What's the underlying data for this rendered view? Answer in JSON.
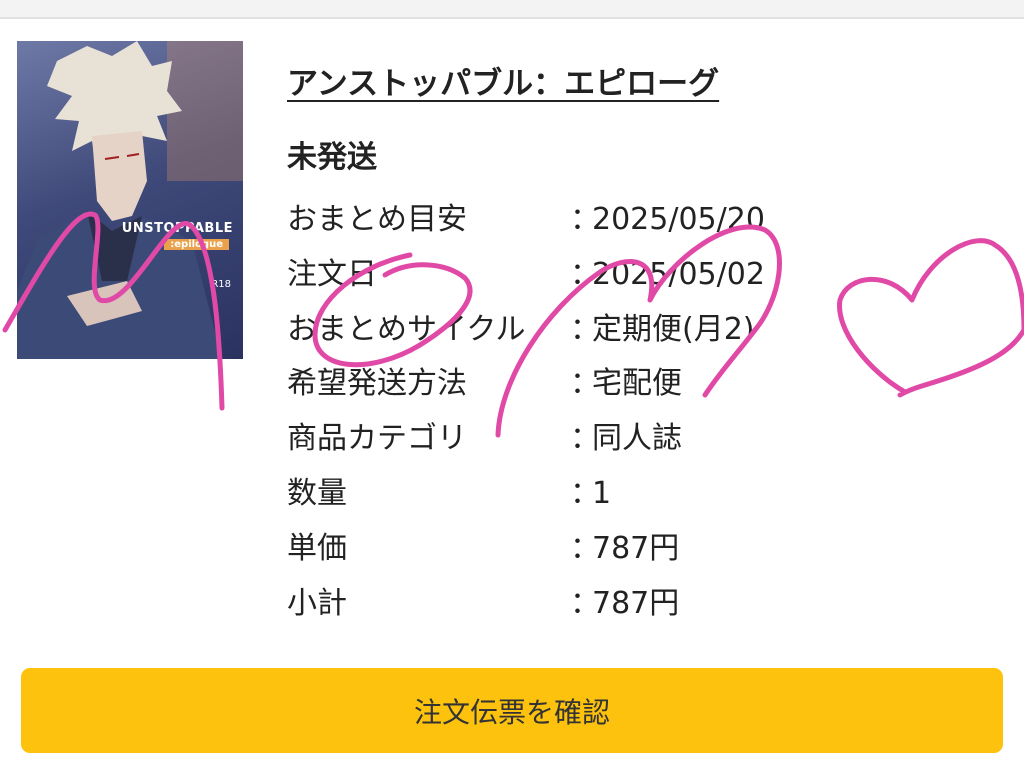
{
  "product": {
    "title": "アンストッパブル：エピローグ",
    "cover": {
      "title_text": "UNSTOPPABLE",
      "subtitle_text": ":epilogue",
      "rating_text": "R18"
    }
  },
  "order": {
    "status": "未発送",
    "details": [
      {
        "label": "おまとめ目安",
        "separator": "：",
        "value": "2025/05/20"
      },
      {
        "label": "注文日",
        "separator": "：",
        "value": "2025/05/02"
      },
      {
        "label": "おまとめサイクル",
        "separator": "：",
        "value": " 定期便(月2)"
      },
      {
        "label": "希望発送方法",
        "separator": "：",
        "value": "宅配便"
      },
      {
        "label": "商品カテゴリ",
        "separator": "：",
        "value": "同人誌"
      },
      {
        "label": "数量",
        "separator": "：",
        "value": "1"
      },
      {
        "label": "単価",
        "separator": "：",
        "value": "787円"
      },
      {
        "label": "小計",
        "separator": "：",
        "value": "787円"
      }
    ]
  },
  "actions": {
    "confirm_label": "注文伝票を確認"
  },
  "colors": {
    "button": "#fcc20d",
    "scribble": "#e04aa6"
  }
}
